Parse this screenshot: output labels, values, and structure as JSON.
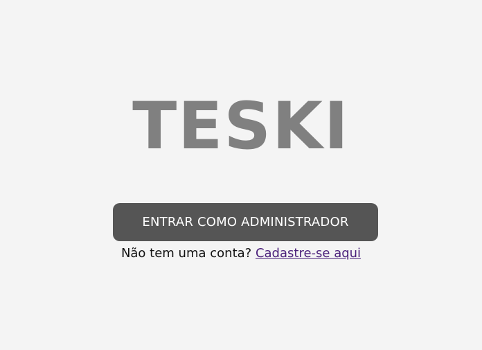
{
  "logo": {
    "text": "TESKI"
  },
  "admin_button": {
    "label": "ENTRAR COMO ADMINISTRADOR"
  },
  "signup": {
    "prompt": "Não tem uma conta?",
    "link_label": "Cadastre-se aqui"
  },
  "colors": {
    "background": "#f4f4f4",
    "logo": "#808080",
    "button_background": "#555555",
    "button_text": "#ffffff",
    "link": "#4a1f7a"
  }
}
